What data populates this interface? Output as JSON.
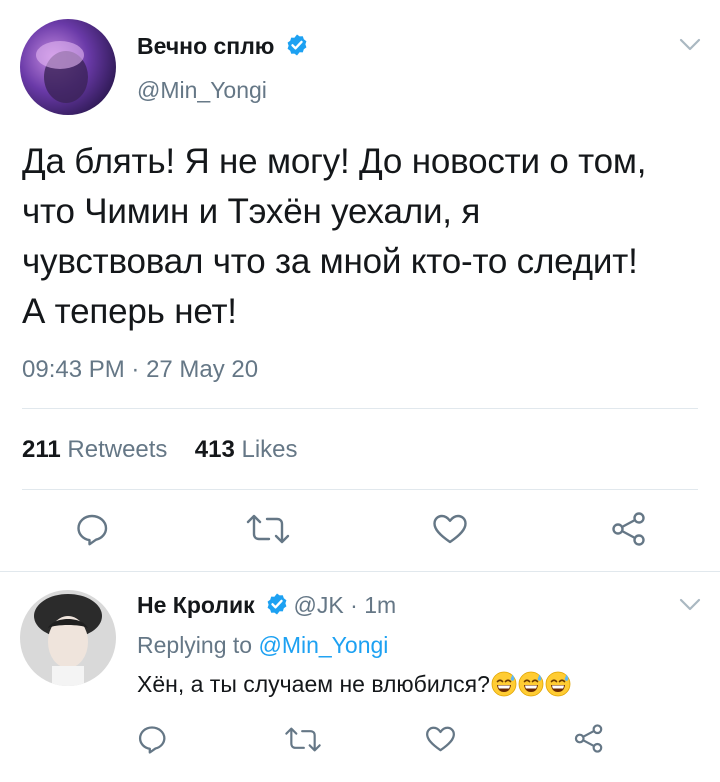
{
  "tweet": {
    "display_name": "Вечно сплю",
    "handle": "@Min_Yongi",
    "text": "Да блять! Я не могу! До новости о том, что Чимин и Тэхён уехали, я чувствовал что за мной кто-то следит! А теперь нет!",
    "time": "09:43 PM",
    "date_sep": " · ",
    "date": "27 May 20",
    "retweets_count": "211",
    "retweets_label": "Retweets",
    "likes_count": "413",
    "likes_label": "Likes"
  },
  "reply": {
    "display_name": "Не Кролик",
    "handle": "@JK",
    "sep": " · ",
    "age": "1m",
    "replying_prefix": "Replying to ",
    "replying_handle": "@Min_Yongi",
    "text": "Хён, а ты случаем не влюбился?",
    "emoji_count": 3
  },
  "colors": {
    "accent": "#1da1f2",
    "text": "#14171a",
    "muted": "#657786",
    "icon": "#657786",
    "divider": "#e1e8ed"
  },
  "icons": [
    "verified-badge-icon",
    "chevron-down-icon",
    "reply-icon",
    "retweet-icon",
    "like-icon",
    "share-icon",
    "grinning-sweat-emoji"
  ]
}
